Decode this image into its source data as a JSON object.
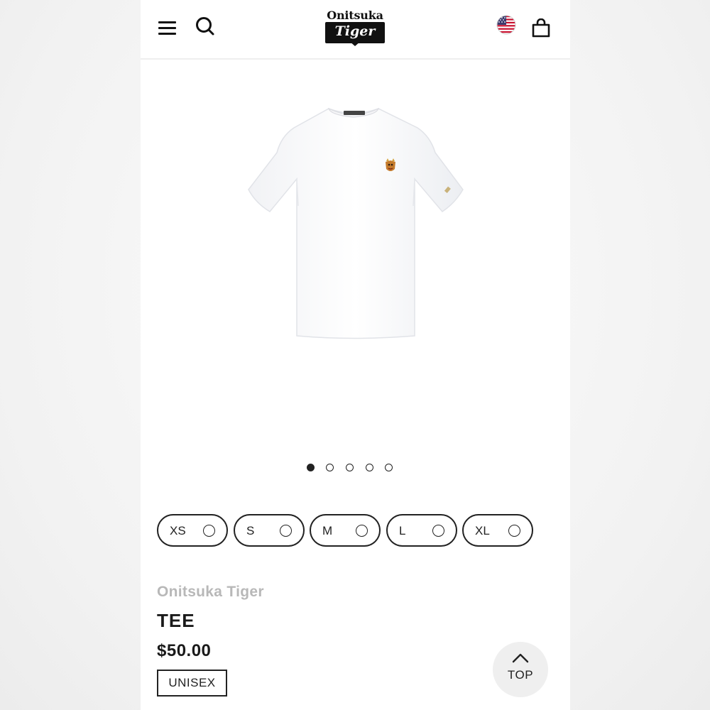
{
  "header": {
    "logo_top": "Onitsuka",
    "logo_bottom": "Tiger",
    "icons": {
      "menu": "hamburger-menu-icon",
      "search": "search-icon",
      "region": "us-flag-icon",
      "bag": "shopping-bag-icon"
    }
  },
  "gallery": {
    "image_count": 5,
    "active_index": 0
  },
  "sizes": [
    {
      "label": "XS"
    },
    {
      "label": "S"
    },
    {
      "label": "M"
    },
    {
      "label": "L"
    },
    {
      "label": "XL"
    }
  ],
  "product": {
    "brand": "Onitsuka Tiger",
    "name": "TEE",
    "price": "$50.00",
    "badge": "UNISEX"
  },
  "back_to_top": {
    "label": "TOP"
  },
  "colors": {
    "text": "#1a1a1a",
    "brand_muted": "#b8b8b8",
    "top_button_bg": "#efefef"
  }
}
